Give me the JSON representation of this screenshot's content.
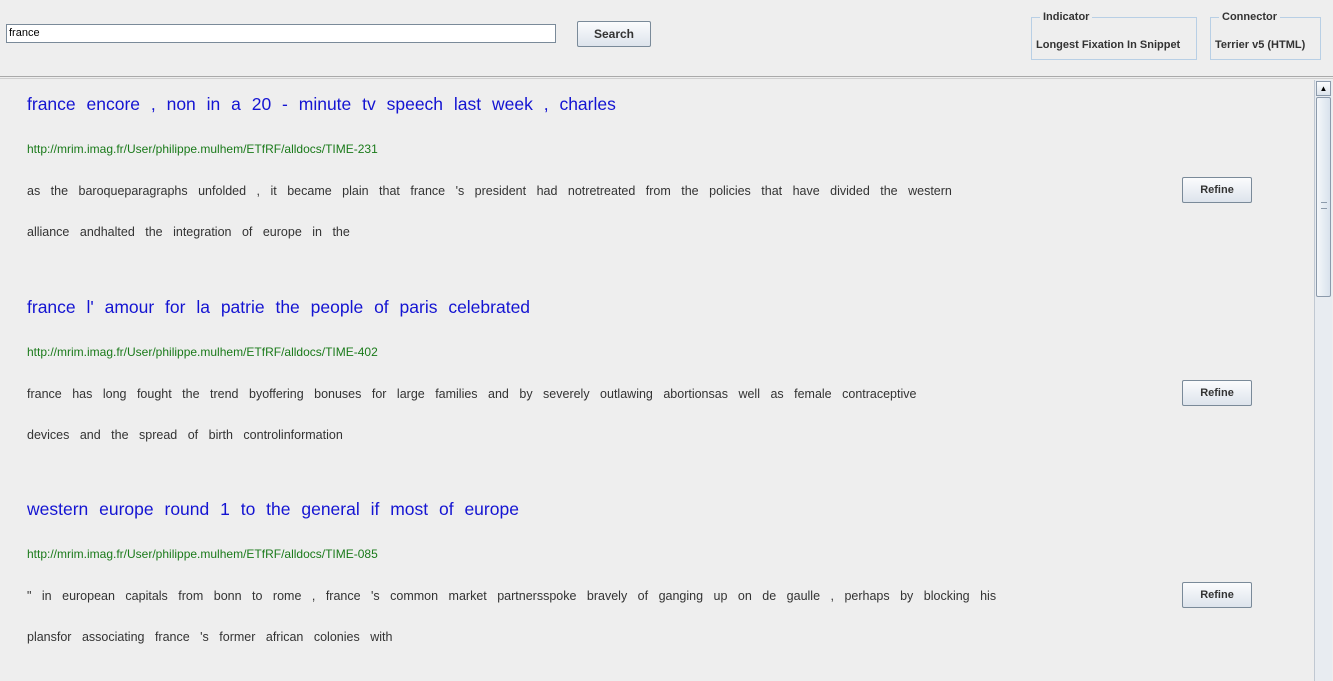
{
  "search": {
    "query": "france",
    "button_label": "Search"
  },
  "indicator": {
    "legend": "Indicator",
    "value": "Longest Fixation In Snippet"
  },
  "connector": {
    "legend": "Connector",
    "value": "Terrier v5 (HTML)"
  },
  "results": [
    {
      "title": "france encore , non in a 20 - minute tv speech last week , charles",
      "url": "http://mrim.imag.fr/User/philippe.mulhem/ETfRF/alldocs/TIME-231",
      "snippet_line1": "as the baroqueparagraphs unfolded , it became plain that france 's president had notretreated from the policies that have divided the western",
      "snippet_line2": "alliance andhalted the integration of europe in the",
      "refine_label": "Refine"
    },
    {
      "title": "france l' amour for la patrie the people of paris celebrated",
      "url": "http://mrim.imag.fr/User/philippe.mulhem/ETfRF/alldocs/TIME-402",
      "snippet_line1": "france has long fought the trend byoffering bonuses for large families and by severely outlawing abortionsas well as female contraceptive",
      "snippet_line2": "devices and the spread of birth controlinformation",
      "refine_label": "Refine"
    },
    {
      "title": "western europe round 1 to the general if most of europe",
      "url": "http://mrim.imag.fr/User/philippe.mulhem/ETfRF/alldocs/TIME-085",
      "snippet_line1": "\" in european capitals from bonn to rome , france 's common market partnersspoke bravely of ganging up on de gaulle , perhaps by blocking his",
      "snippet_line2": "plansfor associating france 's former african colonies with",
      "refine_label": "Refine"
    }
  ],
  "icons": {
    "scroll_up": "arrow-up-icon"
  },
  "colors": {
    "title": "#1414d2",
    "url": "#1a7a1a",
    "background": "#eeeeee"
  }
}
